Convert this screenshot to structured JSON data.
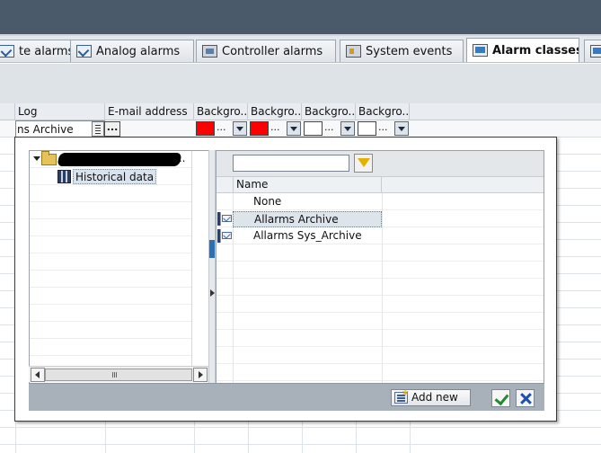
{
  "tabs": [
    {
      "label": "te alarms",
      "icon": "alarm-icon",
      "active": false
    },
    {
      "label": "Analog alarms",
      "icon": "alarm-icon",
      "active": false
    },
    {
      "label": "Controller alarms",
      "icon": "controller-icon",
      "active": false
    },
    {
      "label": "System events",
      "icon": "event-icon",
      "active": false
    },
    {
      "label": "Alarm classes",
      "icon": "class-icon",
      "active": true
    }
  ],
  "grid": {
    "headers": {
      "log": "Log",
      "email": "E-mail address",
      "bg1": "Backgro...",
      "bg2": "Backgro...",
      "bg3": "Backgro...",
      "bg4": "Backgro..."
    },
    "row": {
      "log_value": "ns Archive",
      "ellipsis": "...",
      "swatches": [
        {
          "color": "#ff0000",
          "dots": "..."
        },
        {
          "color": "#ff0000",
          "dots": "..."
        },
        {
          "color": "#ffffff",
          "dots": "..."
        },
        {
          "color": "#ffffff",
          "dots": "..."
        }
      ]
    }
  },
  "popup": {
    "tree": {
      "root_expanded": true,
      "root_dots": "...",
      "child_label": "Historical data"
    },
    "filter": {
      "value": ""
    },
    "list": {
      "header": "Name",
      "items": [
        {
          "label": "None",
          "icon": "none",
          "selected": false
        },
        {
          "label": "Allarms Archive",
          "icon": "archive-icon",
          "selected": true
        },
        {
          "label": "Allarms Sys_Archive",
          "icon": "archive-icon",
          "selected": false
        }
      ]
    },
    "footer": {
      "add_new_label": "Add new"
    }
  }
}
